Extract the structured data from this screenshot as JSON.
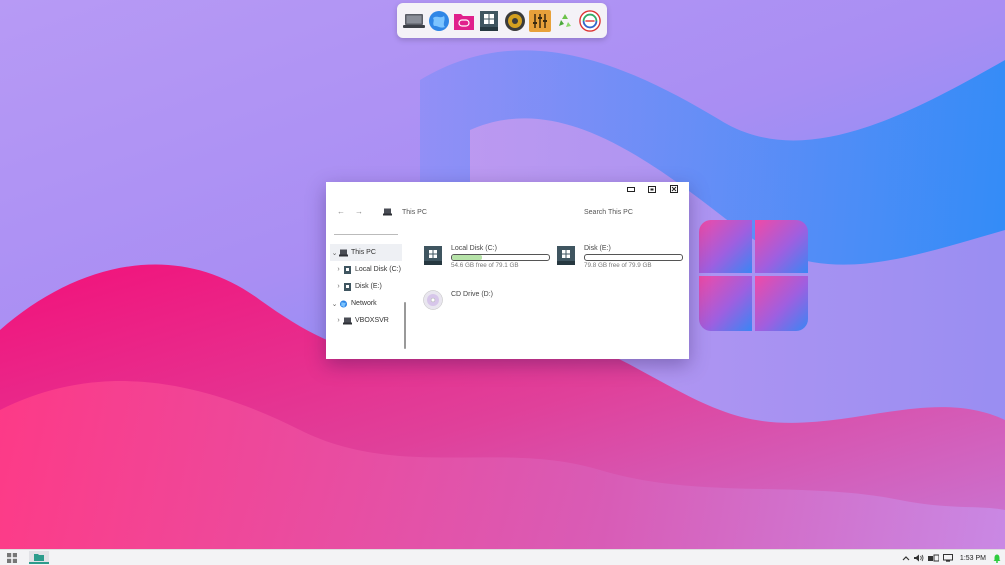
{
  "dock": {
    "items": [
      {
        "name": "computer-icon"
      },
      {
        "name": "globe-browser-icon"
      },
      {
        "name": "game-folder-icon"
      },
      {
        "name": "windows-drive-icon"
      },
      {
        "name": "speaker-icon"
      },
      {
        "name": "equalizer-icon"
      },
      {
        "name": "recycle-icon"
      },
      {
        "name": "swirl-app-icon"
      }
    ]
  },
  "explorer": {
    "address": "This PC",
    "search_placeholder": "Search This PC",
    "nav": {
      "back": "←",
      "forward": "→"
    },
    "tree": [
      {
        "label": "This PC",
        "expanded": true,
        "selected": true,
        "icon": "computer-icon"
      },
      {
        "label": "Local Disk (C:)",
        "expanded": false,
        "icon": "drive-icon"
      },
      {
        "label": "Disk (E:)",
        "expanded": false,
        "icon": "drive-icon"
      },
      {
        "label": "Network",
        "expanded": true,
        "icon": "network-icon"
      },
      {
        "label": "VBOXSVR",
        "expanded": false,
        "icon": "computer-icon"
      }
    ],
    "drives": [
      {
        "name": "Local Disk (C:)",
        "free": "54.6 GB free of 79.1 GB",
        "used_fraction": 0.31
      },
      {
        "name": "Disk (E:)",
        "free": "79.8 GB free of 79.9 GB",
        "used_fraction": 0.0
      },
      {
        "name": "CD Drive (D:)"
      }
    ]
  },
  "taskbar": {
    "time": "1:53 PM",
    "accent": "#2d9c8c"
  }
}
